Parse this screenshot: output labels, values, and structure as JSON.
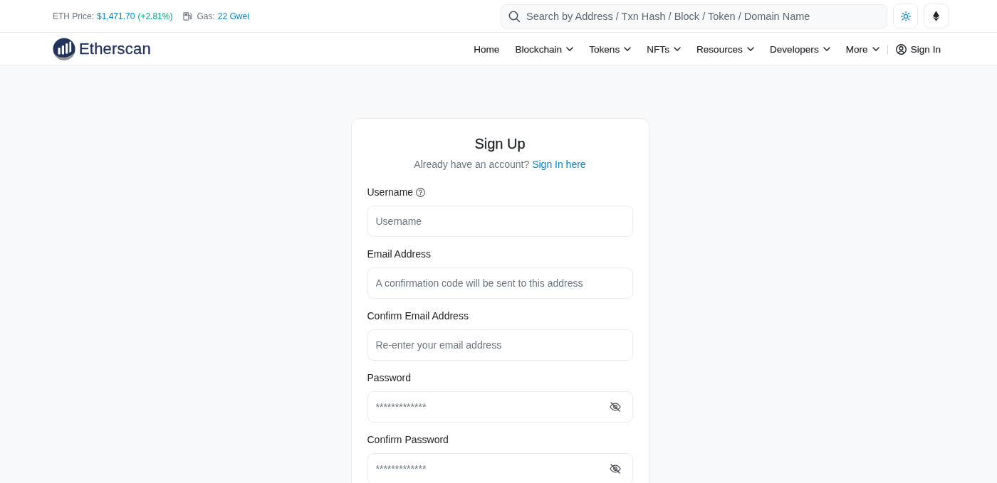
{
  "topbar": {
    "price_label": "ETH Price:",
    "price": "$1,471.70",
    "change": "(+2.81%)",
    "gas_label": "Gas:",
    "gas": "22 Gwei",
    "search": {
      "placeholder": "Search by Address / Txn Hash / Block / Token / Domain Name"
    }
  },
  "navbar": {
    "logo": "Etherscan",
    "items": [
      {
        "label": "Home",
        "dropdown": false
      },
      {
        "label": "Blockchain",
        "dropdown": true
      },
      {
        "label": "Tokens",
        "dropdown": true
      },
      {
        "label": "NFTs",
        "dropdown": true
      },
      {
        "label": "Resources",
        "dropdown": true
      },
      {
        "label": "Developers",
        "dropdown": true
      },
      {
        "label": "More",
        "dropdown": true
      }
    ],
    "sign_in": "Sign In"
  },
  "form": {
    "title": "Sign Up",
    "prompt": "Already have an account?",
    "link": "Sign In here",
    "fields": [
      {
        "kind": "text",
        "label": "Username",
        "help": true,
        "placeholder": "Username"
      },
      {
        "kind": "text",
        "label": "Email Address",
        "help": false,
        "placeholder": "A confirmation code will be sent to this address"
      },
      {
        "kind": "text",
        "label": "Confirm Email Address",
        "help": false,
        "placeholder": "Re-enter your email address"
      },
      {
        "kind": "password",
        "label": "Password",
        "help": false,
        "placeholder": "*************"
      },
      {
        "kind": "password",
        "label": "Confirm Password",
        "help": false,
        "placeholder": "*************"
      }
    ]
  }
}
